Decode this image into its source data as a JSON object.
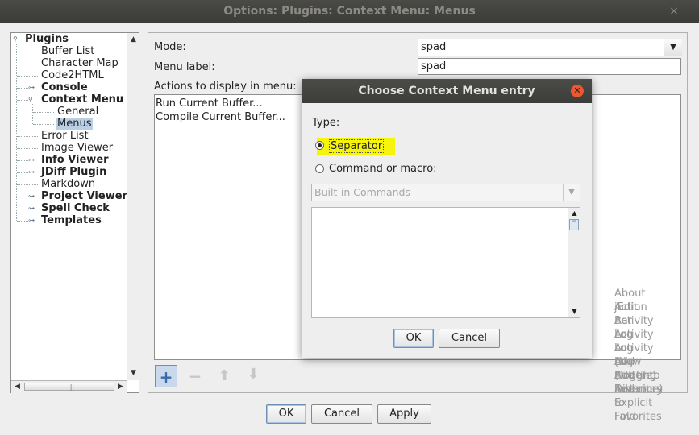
{
  "window": {
    "title": "Options: Plugins: Context Menu: Menus",
    "close_glyph": "×"
  },
  "tree": {
    "root": "Plugins",
    "nodes": [
      {
        "label": "Buffer List",
        "bold": false,
        "expandable": false
      },
      {
        "label": "Character Map",
        "bold": false,
        "expandable": false
      },
      {
        "label": "Code2HTML",
        "bold": false,
        "expandable": false
      },
      {
        "label": "Console",
        "bold": true,
        "expandable": true
      },
      {
        "label": "Context Menu",
        "bold": true,
        "expandable": true,
        "expanded": true
      },
      {
        "label": "General",
        "bold": false,
        "expandable": false,
        "child": true
      },
      {
        "label": "Menus",
        "bold": false,
        "expandable": false,
        "child": true,
        "selected": true
      },
      {
        "label": "Error List",
        "bold": false,
        "expandable": false
      },
      {
        "label": "Image Viewer",
        "bold": false,
        "expandable": false
      },
      {
        "label": "Info Viewer",
        "bold": true,
        "expandable": true
      },
      {
        "label": "JDiff Plugin",
        "bold": true,
        "expandable": true
      },
      {
        "label": "Markdown",
        "bold": false,
        "expandable": false
      },
      {
        "label": "Project Viewer",
        "bold": true,
        "expandable": true
      },
      {
        "label": "Spell Check",
        "bold": true,
        "expandable": true
      },
      {
        "label": "Templates",
        "bold": true,
        "expandable": true
      }
    ]
  },
  "menus_panel": {
    "mode_label": "Mode:",
    "mode_value": "spad",
    "menu_label_label": "Menu label:",
    "menu_label_value": "spad",
    "actions_label": "Actions to display in menu:",
    "actions": [
      "Run Current Buffer...",
      "Compile Current Buffer..."
    ],
    "toolbar": [
      "add-icon",
      "remove-icon",
      "move-up-icon",
      "move-down-icon"
    ]
  },
  "footer": {
    "ok": "OK",
    "cancel": "Cancel",
    "apply": "Apply"
  },
  "dialog": {
    "title": "Choose Context Menu entry",
    "type_label": "Type:",
    "option_separator": "Separator",
    "option_command": "Command or macro:",
    "selected_option": "Separator",
    "highlight_color": "#f6f40a",
    "category_value": "Built-in Commands",
    "commands": [
      "About jEdit...",
      "Action Bar",
      "Activity Log",
      "Activity Log (New Floating Instance)",
      "Activity Log (Toggle)",
      "Add Buffer to Favorites",
      "Add Directory to Favorites",
      "Add Explicit Fold"
    ],
    "ok": "OK",
    "cancel": "Cancel"
  }
}
